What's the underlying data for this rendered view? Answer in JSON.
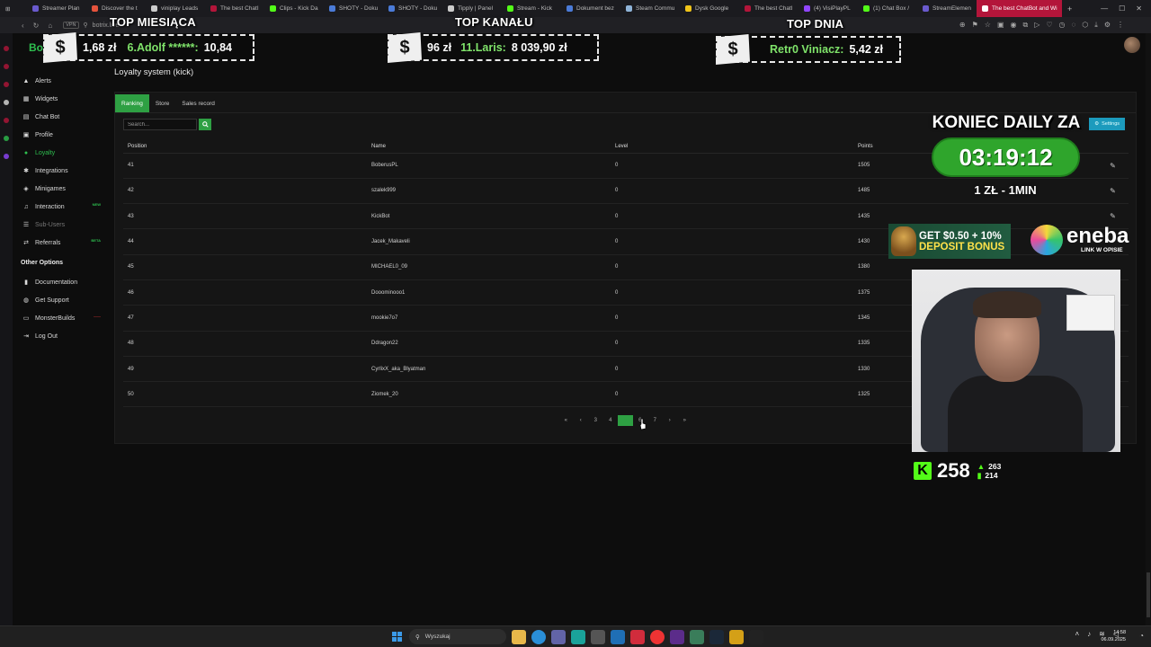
{
  "browser": {
    "tabs": [
      {
        "label": "Streamer Plan",
        "color": "#6a5acd"
      },
      {
        "label": "Discover the t",
        "color": "#e5533c"
      },
      {
        "label": "viniplay Leads",
        "color": "#cccccc"
      },
      {
        "label": "The best ChatI",
        "color": "#b3153a"
      },
      {
        "label": "Clips - Kick Da",
        "color": "#53fc18"
      },
      {
        "label": "SHOTY - Doku",
        "color": "#4b7bd8"
      },
      {
        "label": "SHOTY - Doku",
        "color": "#4b7bd8"
      },
      {
        "label": "Tipply | Panel",
        "color": "#cccccc"
      },
      {
        "label": "Stream - Kick",
        "color": "#53fc18"
      },
      {
        "label": "Dokument bez",
        "color": "#4b7bd8"
      },
      {
        "label": "Steam Commu",
        "color": "#8fb4d8"
      },
      {
        "label": "Dysk Google",
        "color": "#f0c419"
      },
      {
        "label": "The best Chatl",
        "color": "#b3153a"
      },
      {
        "label": "(4) VisiPlayPL",
        "color": "#9146ff"
      },
      {
        "label": "(1) Chat Box /",
        "color": "#53fc18"
      },
      {
        "label": "StreamElemen",
        "color": "#6a5acd"
      }
    ],
    "active_tab": "The best ChatBot and Wi",
    "url_badge": "VPN",
    "url": "botrix.live"
  },
  "overlay": {
    "month_title": "TOP MIESIĄCA",
    "channel_title": "TOP KANAŁU",
    "day_title": "TOP DNIA",
    "month_line_amount": "1,68 zł",
    "month_line_name": "6.Adolf ******:",
    "month_line_value": "10,84",
    "channel_line_amount": "96 zł",
    "channel_line_name": "11.Laris:",
    "channel_line_value": "8 039,90 zł",
    "day_line_name": "Retr0 Viniacz:",
    "day_line_value": "5,42 zł",
    "dollar": "$",
    "koniec": "KONIEC DAILY ZA",
    "timer": "03:19:12",
    "rate": "1 ZŁ - 1MIN",
    "banner_line1": "GET $0.50 + 10%",
    "banner_line2": "DEPOSIT BONUS",
    "eneba_word": "eneba",
    "eneba_sub": "LINK W OPISIE",
    "kick_letter": "K",
    "kick_viewers": "258",
    "kick_up": "263",
    "kick_bars": "214"
  },
  "sidebar": {
    "logo_partial": "Bo",
    "items": [
      {
        "label": "Alerts",
        "icon": "bell-icon"
      },
      {
        "label": "Widgets",
        "icon": "widgets-icon"
      },
      {
        "label": "Chat Bot",
        "icon": "chat-icon"
      },
      {
        "label": "Profile",
        "icon": "profile-icon"
      },
      {
        "label": "Loyalty",
        "icon": "loyalty-icon"
      },
      {
        "label": "Integrations",
        "icon": "integrations-icon"
      },
      {
        "label": "Minigames",
        "icon": "gamepad-icon"
      },
      {
        "label": "Interaction",
        "icon": "music-icon",
        "badge": "NEW"
      },
      {
        "label": "Sub-Users",
        "icon": "users-icon"
      },
      {
        "label": "Referrals",
        "icon": "referrals-icon",
        "badge": "BETA"
      }
    ],
    "other_heading": "Other Options",
    "other_items": [
      {
        "label": "Documentation",
        "icon": "doc-icon"
      },
      {
        "label": "Get Support",
        "icon": "support-icon"
      },
      {
        "label": "MonsterBuilds",
        "icon": "laptop-icon"
      },
      {
        "label": "Log Out",
        "icon": "logout-icon"
      }
    ]
  },
  "page": {
    "title": "Loyalty system (kick)",
    "tabs": [
      "Ranking",
      "Store",
      "Sales record"
    ],
    "search_placeholder": "Search...",
    "settings_label": "Settings",
    "columns": [
      "Position",
      "Name",
      "Level",
      "Points"
    ],
    "rows": [
      {
        "position": "41",
        "name": "BoberusPL",
        "level": "0",
        "points": "1505"
      },
      {
        "position": "42",
        "name": "szalek999",
        "level": "0",
        "points": "1485"
      },
      {
        "position": "43",
        "name": "KickBot",
        "level": "0",
        "points": "1435"
      },
      {
        "position": "44",
        "name": "Jacek_Makaveli",
        "level": "0",
        "points": "1430"
      },
      {
        "position": "45",
        "name": "MICHAEL0_09",
        "level": "0",
        "points": "1380"
      },
      {
        "position": "46",
        "name": "Dooominooo1",
        "level": "0",
        "points": "1375"
      },
      {
        "position": "47",
        "name": "mookie7o7",
        "level": "0",
        "points": "1345"
      },
      {
        "position": "48",
        "name": "Ddragon22",
        "level": "0",
        "points": "1335"
      },
      {
        "position": "49",
        "name": "CyrlixX_aka_Blyatman",
        "level": "0",
        "points": "1330"
      },
      {
        "position": "50",
        "name": "Ziomek_20",
        "level": "0",
        "points": "1325"
      }
    ],
    "pagination": [
      "«",
      "‹",
      "3",
      "4",
      "5",
      "6",
      "7",
      "›",
      "»"
    ],
    "current_page": "5"
  },
  "taskbar": {
    "search_label": "Wyszukaj",
    "time": "14:58",
    "date": "06.09.2025"
  }
}
